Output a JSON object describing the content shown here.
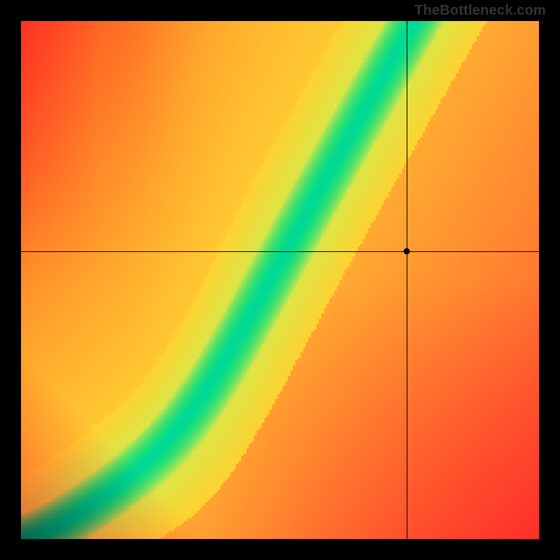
{
  "watermark": "TheBottleneck.com",
  "chart_data": {
    "type": "heatmap",
    "title": "",
    "xlabel": "",
    "ylabel": "",
    "xlim": [
      0,
      1
    ],
    "ylim": [
      0,
      1
    ],
    "crosshair": {
      "x": 0.745,
      "y": 0.555
    },
    "ridge": {
      "description": "Optimal match curve (green ridge) — normalized (x,y) pairs",
      "points": [
        [
          0.0,
          0.0
        ],
        [
          0.05,
          0.035
        ],
        [
          0.1,
          0.075
        ],
        [
          0.15,
          0.12
        ],
        [
          0.2,
          0.17
        ],
        [
          0.25,
          0.225
        ],
        [
          0.3,
          0.285
        ],
        [
          0.35,
          0.35
        ],
        [
          0.4,
          0.42
        ],
        [
          0.45,
          0.5
        ],
        [
          0.5,
          0.575
        ],
        [
          0.55,
          0.655
        ],
        [
          0.6,
          0.735
        ],
        [
          0.65,
          0.815
        ],
        [
          0.7,
          0.89
        ],
        [
          0.75,
          0.955
        ],
        [
          0.78,
          1.0
        ]
      ]
    },
    "ridge_params": {
      "slope_lo": 1.05,
      "pow_lo": 1.3,
      "slope_hi": 1.75,
      "transition_x": 0.33,
      "transition_width": 0.15
    },
    "band_half_width": 0.055,
    "colors": {
      "optimal": "#00d99a",
      "near": "#f5e63c",
      "mid": "#ff9e24",
      "far": "#ff2f2f"
    }
  }
}
